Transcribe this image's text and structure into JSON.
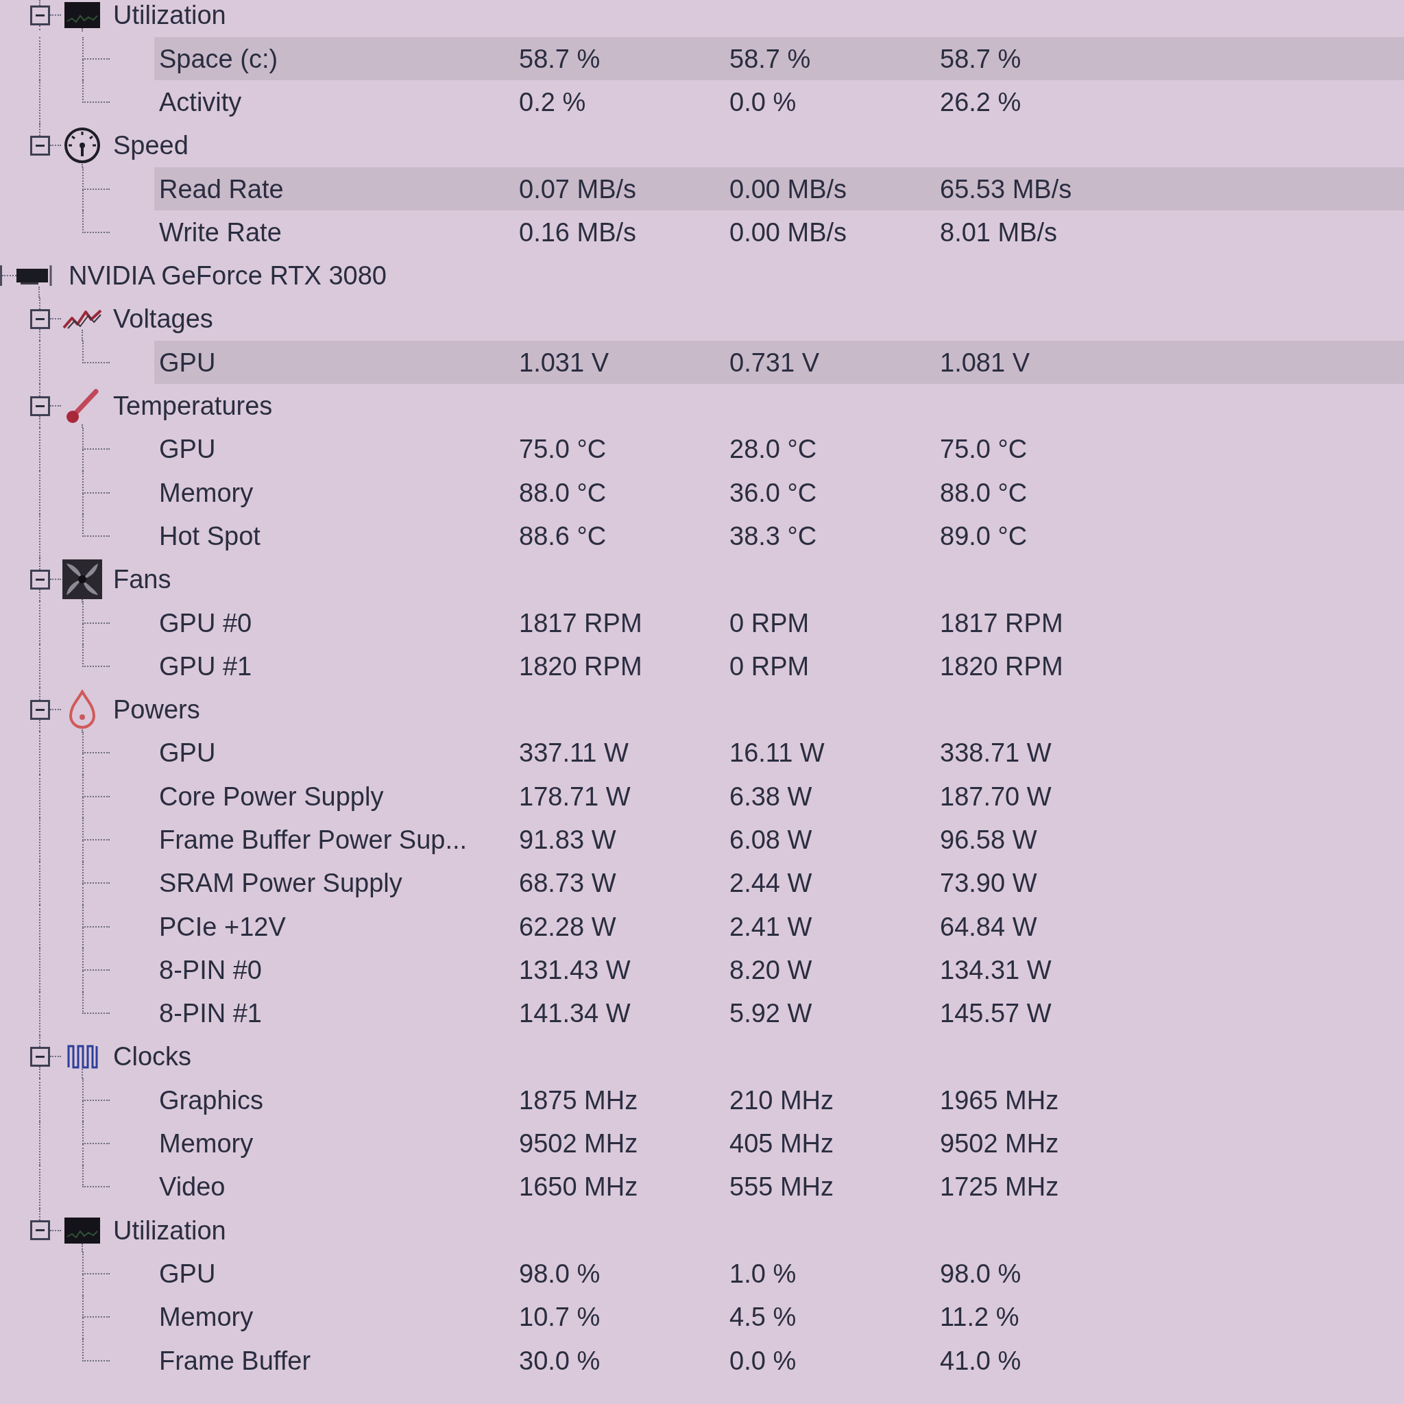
{
  "devices": [
    {
      "children": [
        {
          "kind": "utilization",
          "label": "Utilization",
          "expanded": true,
          "children": [
            {
              "label": "Space (c:)",
              "values": [
                "58.7 %",
                "58.7 %",
                "58.7 %"
              ],
              "highlighted": true
            },
            {
              "label": "Activity",
              "values": [
                "0.2 %",
                "0.0 %",
                "26.2 %"
              ],
              "highlighted": false
            }
          ]
        },
        {
          "kind": "speed",
          "label": "Speed",
          "expanded": true,
          "children": [
            {
              "label": "Read Rate",
              "values": [
                "0.07 MB/s",
                "0.00 MB/s",
                "65.53 MB/s"
              ],
              "highlighted": true
            },
            {
              "label": "Write Rate",
              "values": [
                "0.16 MB/s",
                "0.00 MB/s",
                "8.01 MB/s"
              ],
              "highlighted": false
            }
          ]
        }
      ]
    },
    {
      "kind": "gpu",
      "label": "NVIDIA GeForce RTX 3080",
      "children": [
        {
          "kind": "voltages",
          "label": "Voltages",
          "expanded": true,
          "children": [
            {
              "label": "GPU",
              "values": [
                "1.031 V",
                "0.731 V",
                "1.081 V"
              ],
              "highlighted": true
            }
          ]
        },
        {
          "kind": "temperatures",
          "label": "Temperatures",
          "expanded": true,
          "children": [
            {
              "label": "GPU",
              "values": [
                "75.0 °C",
                "28.0 °C",
                "75.0 °C"
              ],
              "highlighted": false
            },
            {
              "label": "Memory",
              "values": [
                "88.0 °C",
                "36.0 °C",
                "88.0 °C"
              ],
              "highlighted": false
            },
            {
              "label": "Hot Spot",
              "values": [
                "88.6 °C",
                "38.3 °C",
                "89.0 °C"
              ],
              "highlighted": false
            }
          ]
        },
        {
          "kind": "fans",
          "label": "Fans",
          "expanded": true,
          "children": [
            {
              "label": "GPU #0",
              "values": [
                "1817 RPM",
                "0 RPM",
                "1817 RPM"
              ],
              "highlighted": false
            },
            {
              "label": "GPU #1",
              "values": [
                "1820 RPM",
                "0 RPM",
                "1820 RPM"
              ],
              "highlighted": false
            }
          ]
        },
        {
          "kind": "powers",
          "label": "Powers",
          "expanded": true,
          "children": [
            {
              "label": "GPU",
              "values": [
                "337.11 W",
                "16.11 W",
                "338.71 W"
              ],
              "highlighted": false
            },
            {
              "label": "Core Power Supply",
              "values": [
                "178.71 W",
                "6.38 W",
                "187.70 W"
              ],
              "highlighted": false
            },
            {
              "label": "Frame Buffer Power Sup...",
              "values": [
                "91.83 W",
                "6.08 W",
                "96.58 W"
              ],
              "highlighted": false
            },
            {
              "label": "SRAM Power Supply",
              "values": [
                "68.73 W",
                "2.44 W",
                "73.90 W"
              ],
              "highlighted": false
            },
            {
              "label": "PCIe +12V",
              "values": [
                "62.28 W",
                "2.41 W",
                "64.84 W"
              ],
              "highlighted": false
            },
            {
              "label": "8-PIN #0",
              "values": [
                "131.43 W",
                "8.20 W",
                "134.31 W"
              ],
              "highlighted": false
            },
            {
              "label": "8-PIN #1",
              "values": [
                "141.34 W",
                "5.92 W",
                "145.57 W"
              ],
              "highlighted": false
            }
          ]
        },
        {
          "kind": "clocks",
          "label": "Clocks",
          "expanded": true,
          "children": [
            {
              "label": "Graphics",
              "values": [
                "1875 MHz",
                "210 MHz",
                "1965 MHz"
              ],
              "highlighted": false
            },
            {
              "label": "Memory",
              "values": [
                "9502 MHz",
                "405 MHz",
                "9502 MHz"
              ],
              "highlighted": false
            },
            {
              "label": "Video",
              "values": [
                "1650 MHz",
                "555 MHz",
                "1725 MHz"
              ],
              "highlighted": false
            }
          ]
        },
        {
          "kind": "utilization",
          "label": "Utilization",
          "expanded": true,
          "children": [
            {
              "label": "GPU",
              "values": [
                "98.0 %",
                "1.0 %",
                "98.0 %"
              ],
              "highlighted": false
            },
            {
              "label": "Memory",
              "values": [
                "10.7 %",
                "4.5 %",
                "11.2 %"
              ],
              "highlighted": false
            },
            {
              "label": "Frame Buffer",
              "values": [
                "30.0 %",
                "0.0 %",
                "41.0 %"
              ],
              "highlighted": false
            }
          ]
        }
      ]
    }
  ]
}
